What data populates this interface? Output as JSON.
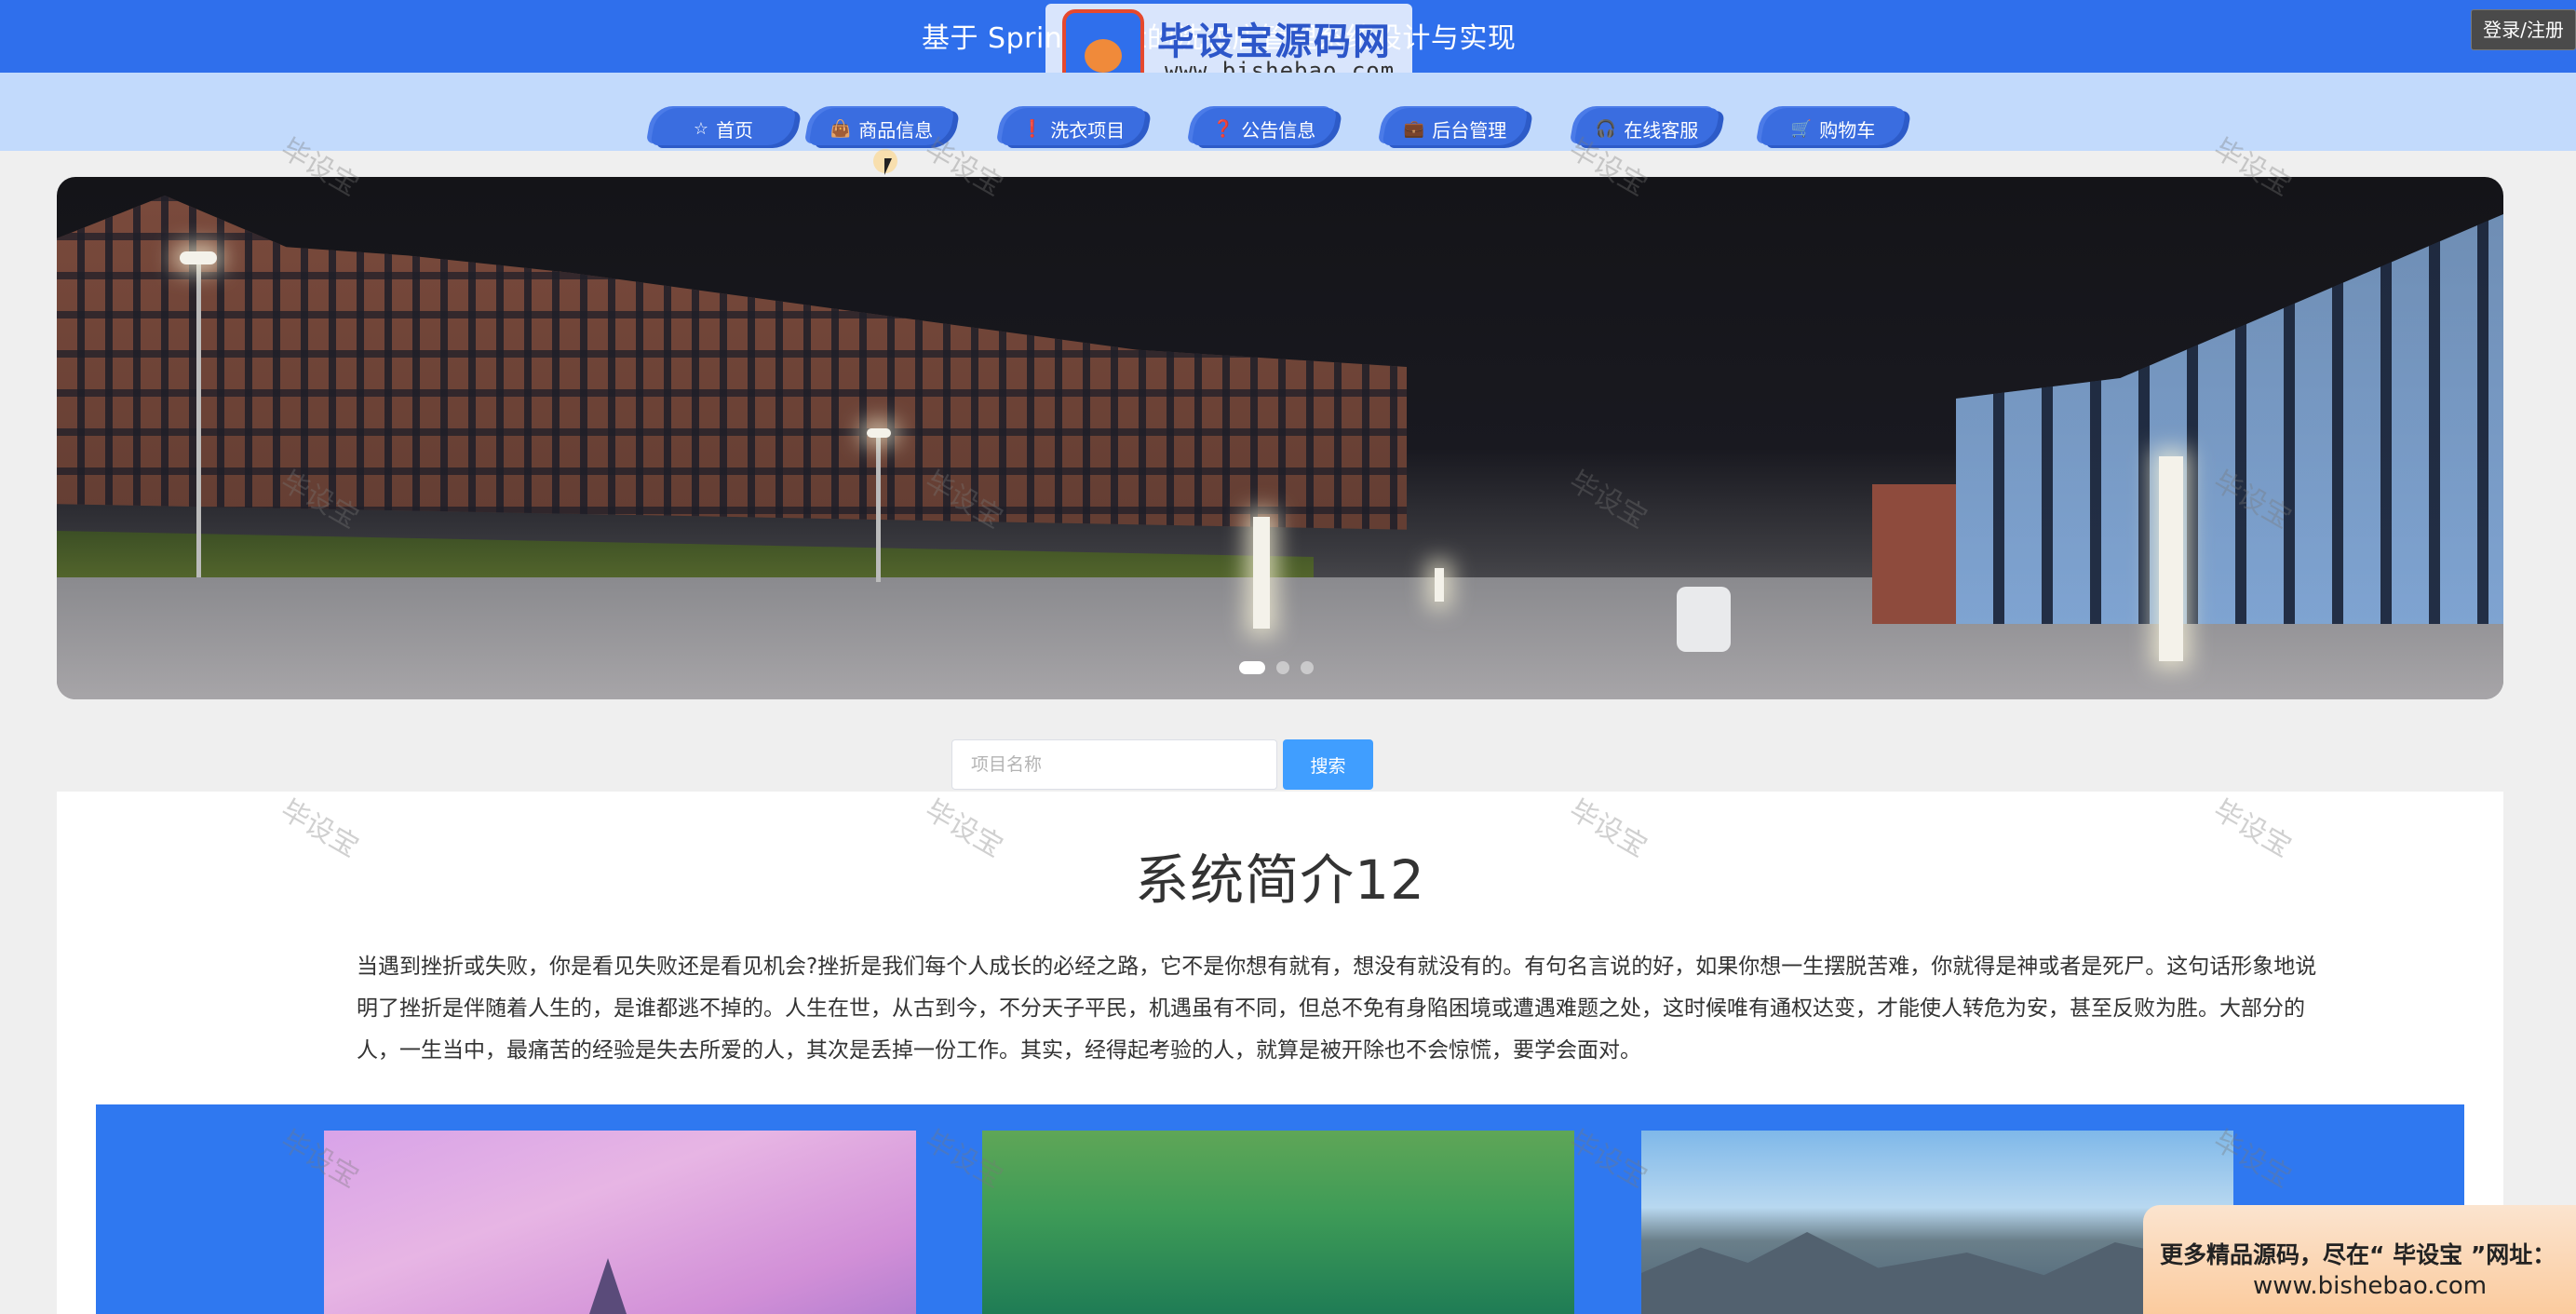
{
  "header": {
    "title": "基于 SpringBoot的洗衣店管理系统设计与实现",
    "login_label": "登录/注册"
  },
  "logo": {
    "text": "毕设宝源码网",
    "url": "www.bishebao.com"
  },
  "nav": {
    "items": [
      {
        "label": "首页",
        "icon": "star-icon"
      },
      {
        "label": "商品信息",
        "icon": "bag-icon"
      },
      {
        "label": "洗衣项目",
        "icon": "info-icon"
      },
      {
        "label": "公告信息",
        "icon": "question-icon"
      },
      {
        "label": "后台管理",
        "icon": "briefcase-icon"
      },
      {
        "label": "在线客服",
        "icon": "headset-icon"
      },
      {
        "label": "购物车",
        "icon": "cart-icon"
      }
    ]
  },
  "banner": {
    "slide_count": 3,
    "active_slide": 1
  },
  "search": {
    "placeholder": "项目名称",
    "button_label": "搜索"
  },
  "intro": {
    "title": "系统简介12",
    "text": "当遇到挫折或失败，你是看见失败还是看见机会?挫折是我们每个人成长的必经之路，它不是你想有就有，想没有就没有的。有句名言说的好，如果你想一生摆脱苦难，你就得是神或者是死尸。这句话形象地说明了挫折是伴随着人生的，是谁都逃不掉的。人生在世，从古到今，不分天子平民，机遇虽有不同，但总不免有身陷困境或遭遇难题之处，这时候唯有通权达变，才能使人转危为安，甚至反败为胜。大部分的人，一生当中，最痛苦的经验是失去所爱的人，其次是丢掉一份工作。其实，经得起考验的人，就算是被开除也不会惊慌，要学会面对。"
  },
  "watermark": {
    "text": "毕设宝"
  },
  "promo": {
    "line1": "更多精品源码，尽在“ 毕设宝 ”网址：",
    "line2": "www.bishebao.com"
  },
  "colors": {
    "primary": "#2f6fec",
    "nav_bg": "#c2dafc",
    "search_button": "#409eff",
    "gallery_bg": "#2f78f0"
  }
}
